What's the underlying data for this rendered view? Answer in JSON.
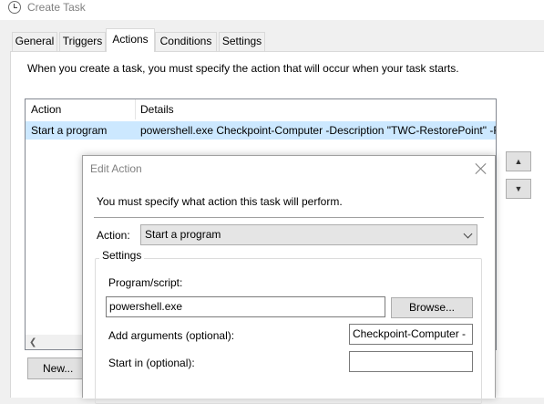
{
  "window": {
    "title": "Create Task"
  },
  "tabs": [
    {
      "label": "General"
    },
    {
      "label": "Triggers"
    },
    {
      "label": "Actions",
      "active": true
    },
    {
      "label": "Conditions"
    },
    {
      "label": "Settings"
    }
  ],
  "actions_tab": {
    "intro": "When you create a task, you must specify the action that will occur when your task starts.",
    "columns": [
      "Action",
      "Details"
    ],
    "rows": [
      {
        "action": "Start a program",
        "details": "powershell.exe Checkpoint-Computer -Description \"TWC-RestorePoint\" -R"
      }
    ],
    "new_label": "New...",
    "up_icon": "triangle-up-icon",
    "down_icon": "triangle-down-icon"
  },
  "dialog": {
    "title": "Edit Action",
    "instruction": "You must specify what action this task will perform.",
    "action_label": "Action:",
    "action_value": "Start a program",
    "settings_legend": "Settings",
    "program_label": "Program/script:",
    "program_value": "powershell.exe",
    "browse_label": "Browse...",
    "args_label": "Add arguments (optional):",
    "args_value": "Checkpoint-Computer -",
    "startin_label": "Start in (optional):",
    "startin_value": ""
  },
  "colors": {
    "selection": "#cce8ff",
    "window_bg": "#f0f0f0",
    "title_text": "#808080"
  }
}
